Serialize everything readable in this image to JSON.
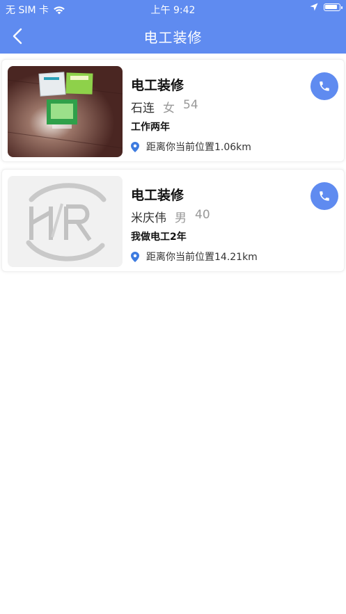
{
  "status_bar": {
    "carrier": "无 SIM 卡",
    "time": "上午 9:42",
    "battery_level": 0.9
  },
  "nav": {
    "title": "电工装修"
  },
  "listings": [
    {
      "title": "电工装修",
      "name": "石连",
      "gender": "女",
      "age": "54",
      "description": "工作两年",
      "distance": "距离你当前位置1.06km"
    },
    {
      "title": "电工装修",
      "name": "米庆伟",
      "gender": "男",
      "age": "40",
      "description": "我做电工2年",
      "distance": "距离你当前位置14.21km"
    }
  ],
  "colors": {
    "primary": "#5f8bf0",
    "location_pin": "#3d7be0"
  },
  "icons": {
    "back": "back-chevron-icon",
    "call": "phone-icon",
    "location": "location-pin-icon",
    "wifi": "wifi-icon",
    "gps": "location-arrow-icon",
    "battery": "battery-icon"
  }
}
